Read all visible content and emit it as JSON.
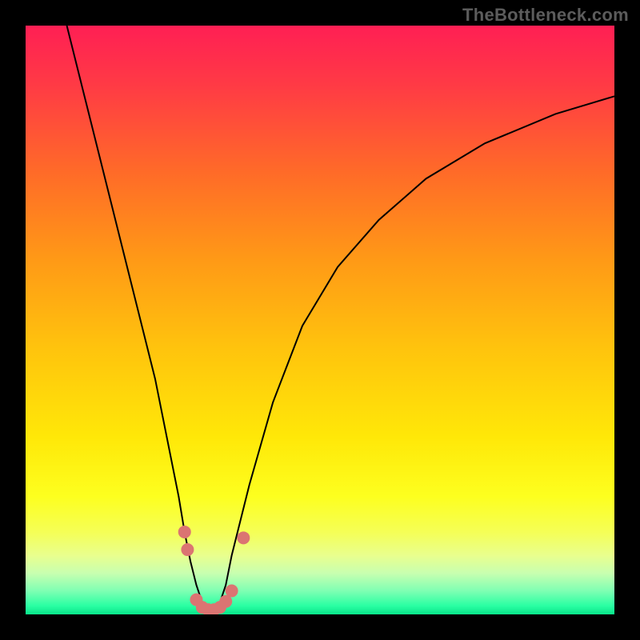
{
  "watermark": "TheBottleneck.com",
  "chart_data": {
    "type": "line",
    "title": "",
    "xlabel": "",
    "ylabel": "",
    "xlim": [
      0,
      100
    ],
    "ylim": [
      0,
      100
    ],
    "grid": false,
    "legend": false,
    "series": [
      {
        "name": "bottleneck-curve",
        "x": [
          7,
          10,
          13,
          16,
          19,
          22,
          24,
          26,
          27,
          28,
          29,
          30,
          31,
          32,
          33,
          34,
          35,
          38,
          42,
          47,
          53,
          60,
          68,
          78,
          90,
          100
        ],
        "y": [
          100,
          88,
          76,
          64,
          52,
          40,
          30,
          20,
          14,
          9,
          5,
          2,
          0,
          0,
          2,
          5,
          10,
          22,
          36,
          49,
          59,
          67,
          74,
          80,
          85,
          88
        ],
        "stroke": "#000000",
        "stroke_width": 2
      }
    ],
    "markers": [
      {
        "x": 27,
        "y": 14,
        "color": "#db7472",
        "r": 8
      },
      {
        "x": 27.5,
        "y": 11,
        "color": "#db7472",
        "r": 8
      },
      {
        "x": 29,
        "y": 2.5,
        "color": "#db7472",
        "r": 8
      },
      {
        "x": 30,
        "y": 1.2,
        "color": "#db7472",
        "r": 8
      },
      {
        "x": 31,
        "y": 0.8,
        "color": "#db7472",
        "r": 8
      },
      {
        "x": 32,
        "y": 0.8,
        "color": "#db7472",
        "r": 8
      },
      {
        "x": 33,
        "y": 1.2,
        "color": "#db7472",
        "r": 8
      },
      {
        "x": 34,
        "y": 2.2,
        "color": "#db7472",
        "r": 8
      },
      {
        "x": 35,
        "y": 4,
        "color": "#db7472",
        "r": 8
      },
      {
        "x": 37,
        "y": 13,
        "color": "#db7472",
        "r": 8
      }
    ],
    "background_gradient": {
      "stops": [
        {
          "offset": 0.0,
          "color": "#ff1f54"
        },
        {
          "offset": 0.1,
          "color": "#ff3a45"
        },
        {
          "offset": 0.25,
          "color": "#ff6b28"
        },
        {
          "offset": 0.4,
          "color": "#ff9a16"
        },
        {
          "offset": 0.55,
          "color": "#ffc40d"
        },
        {
          "offset": 0.7,
          "color": "#ffe808"
        },
        {
          "offset": 0.8,
          "color": "#fdff1f"
        },
        {
          "offset": 0.86,
          "color": "#f5ff56"
        },
        {
          "offset": 0.9,
          "color": "#e9ff8e"
        },
        {
          "offset": 0.93,
          "color": "#c8ffb0"
        },
        {
          "offset": 0.96,
          "color": "#7fffb3"
        },
        {
          "offset": 0.985,
          "color": "#2bffa3"
        },
        {
          "offset": 1.0,
          "color": "#08e58a"
        }
      ]
    }
  }
}
